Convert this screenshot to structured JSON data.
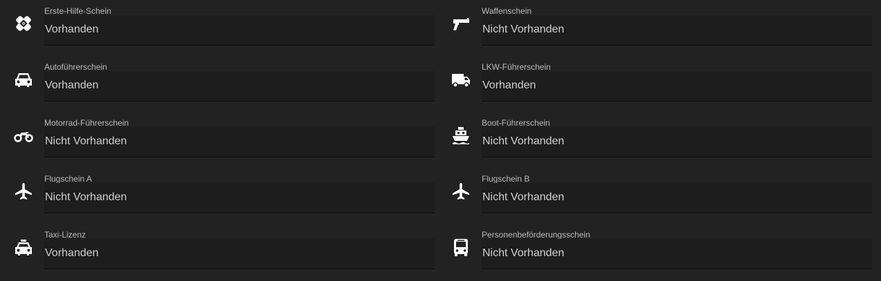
{
  "licenses": [
    {
      "label": "Erste-Hilfe-Schein",
      "value": "Vorhanden",
      "icon": "first-aid-bandage-icon"
    },
    {
      "label": "Waffenschein",
      "value": "Nicht Vorhanden",
      "icon": "pistol-icon"
    },
    {
      "label": "Autoführerschein",
      "value": "Vorhanden",
      "icon": "car-icon"
    },
    {
      "label": "LKW-Führerschein",
      "value": "Vorhanden",
      "icon": "truck-icon"
    },
    {
      "label": "Motorrad-Führerschein",
      "value": "Nicht Vorhanden",
      "icon": "motorcycle-icon"
    },
    {
      "label": "Boot-Führerschein",
      "value": "Nicht Vorhanden",
      "icon": "ship-icon"
    },
    {
      "label": "Flugschein A",
      "value": "Nicht Vorhanden",
      "icon": "airplane-icon"
    },
    {
      "label": "Flugschein B",
      "value": "Nicht Vorhanden",
      "icon": "airplane-icon"
    },
    {
      "label": "Taxi-Lizenz",
      "value": "Vorhanden",
      "icon": "taxi-icon"
    },
    {
      "label": "Personenbeförderungsschein",
      "value": "Nicht Vorhanden",
      "icon": "bus-icon"
    }
  ],
  "colors": {
    "background": "#222222",
    "field_background": "#1d1d1d",
    "label": "#b9b9b9",
    "value": "#cfcfcf",
    "icon": "#ffffff"
  }
}
